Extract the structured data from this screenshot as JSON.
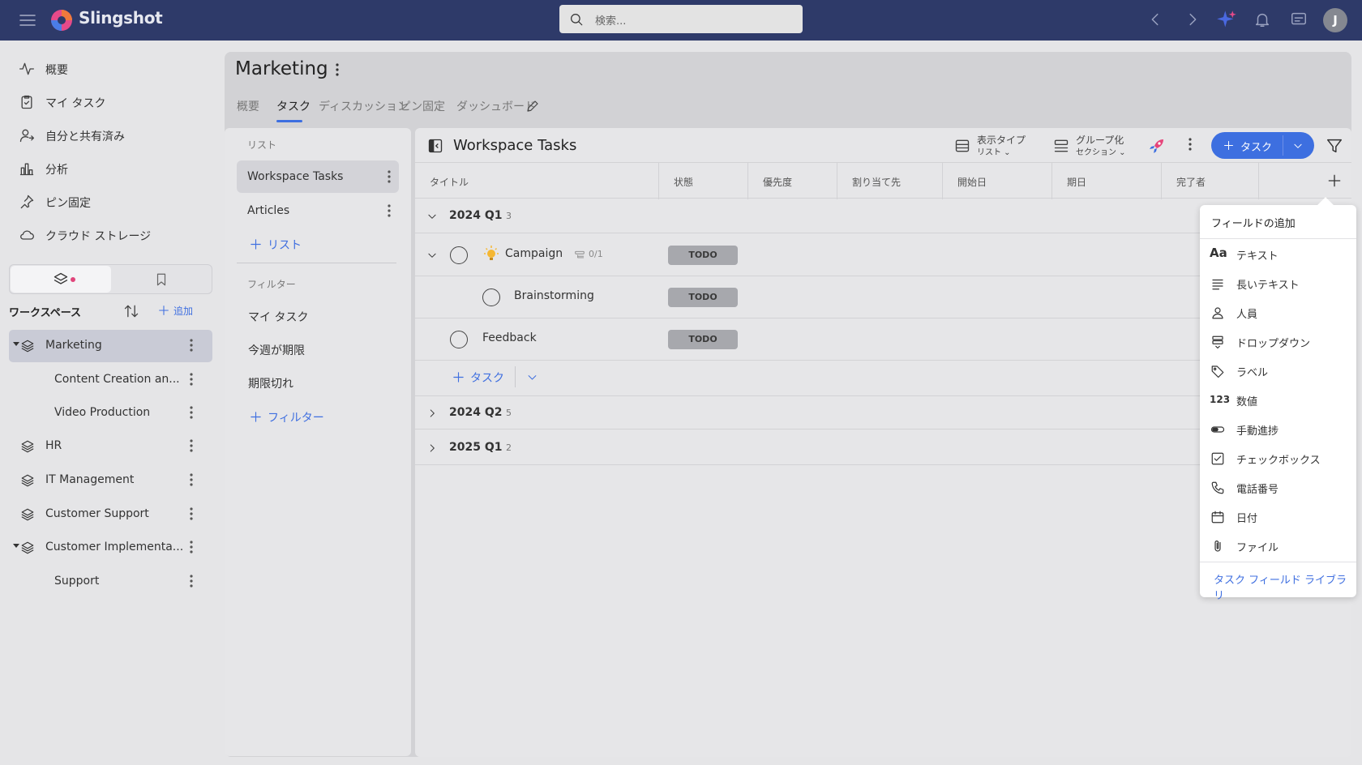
{
  "app": {
    "brand": "Slingshot",
    "search_placeholder": "検索...",
    "avatar_initial": "J"
  },
  "nav": {
    "items": [
      {
        "label": "概要",
        "icon": "activity-icon"
      },
      {
        "label": "マイ タスク",
        "icon": "clipboard-check-icon"
      },
      {
        "label": "自分と共有済み",
        "icon": "user-shared-icon"
      },
      {
        "label": "分析",
        "icon": "bar-chart-icon"
      },
      {
        "label": "ピン固定",
        "icon": "pin-icon"
      },
      {
        "label": "クラウド ストレージ",
        "icon": "cloud-icon"
      }
    ]
  },
  "workspace": {
    "header": "ワークスペース",
    "add_label": "追加",
    "items": [
      {
        "label": "Marketing"
      },
      {
        "label": "Content Creation an..."
      },
      {
        "label": "Video Production"
      },
      {
        "label": "HR"
      },
      {
        "label": "IT Management"
      },
      {
        "label": "Customer Support"
      },
      {
        "label": "Customer Implementa..."
      },
      {
        "label": "Support"
      }
    ]
  },
  "project": {
    "title": "Marketing",
    "tabs": [
      "概要",
      "タスク",
      "ディスカッション",
      "ピン固定",
      "ダッシュボード"
    ],
    "active_tab": "タスク"
  },
  "lists": {
    "section": "リスト",
    "items": [
      "Workspace Tasks",
      "Articles"
    ],
    "add_list": "リスト",
    "filter_section": "フィルター",
    "filters": [
      "マイ タスク",
      "今週が期限",
      "期限切れ"
    ],
    "add_filter": "フィルター"
  },
  "tasks": {
    "title": "Workspace Tasks",
    "view_type": {
      "label": "表示タイプ",
      "value": "リスト"
    },
    "group_by": {
      "label": "グループ化",
      "value": "セクション"
    },
    "add_task": "タスク",
    "columns": [
      "タイトル",
      "状態",
      "優先度",
      "割り当て先",
      "開始日",
      "期日",
      "完了者"
    ],
    "groups": [
      {
        "name": "2024 Q1",
        "count": "3",
        "expanded": true
      },
      {
        "name": "2024 Q2",
        "count": "5",
        "expanded": false
      },
      {
        "name": "2025 Q1",
        "count": "2",
        "expanded": false
      }
    ],
    "rows": [
      {
        "title": "Campaign",
        "subtasks": "0/1",
        "status": "TODO"
      },
      {
        "title": "Brainstorming",
        "status": "TODO"
      },
      {
        "title": "Feedback",
        "status": "TODO"
      }
    ],
    "add_row": "タスク"
  },
  "field_menu": {
    "title": "フィールドの追加",
    "items": [
      {
        "label": "テキスト",
        "icon": "text-icon"
      },
      {
        "label": "長いテキスト",
        "icon": "long-text-icon"
      },
      {
        "label": "人員",
        "icon": "person-icon"
      },
      {
        "label": "ドロップダウン",
        "icon": "dropdown-icon"
      },
      {
        "label": "ラベル",
        "icon": "tag-icon"
      },
      {
        "label": "数値",
        "icon": "number-icon"
      },
      {
        "label": "手動進捗",
        "icon": "progress-icon"
      },
      {
        "label": "チェックボックス",
        "icon": "checkbox-icon"
      },
      {
        "label": "電話番号",
        "icon": "phone-icon"
      },
      {
        "label": "日付",
        "icon": "calendar-icon"
      },
      {
        "label": "ファイル",
        "icon": "paperclip-icon"
      }
    ],
    "number_glyph": "123",
    "text_glyph": "Aa",
    "footer": "タスク フィールド ライブラリ"
  },
  "colors": {
    "topbar": "#2e3a69",
    "accent": "#3d6fe0",
    "badge": "#a7a8ad"
  }
}
